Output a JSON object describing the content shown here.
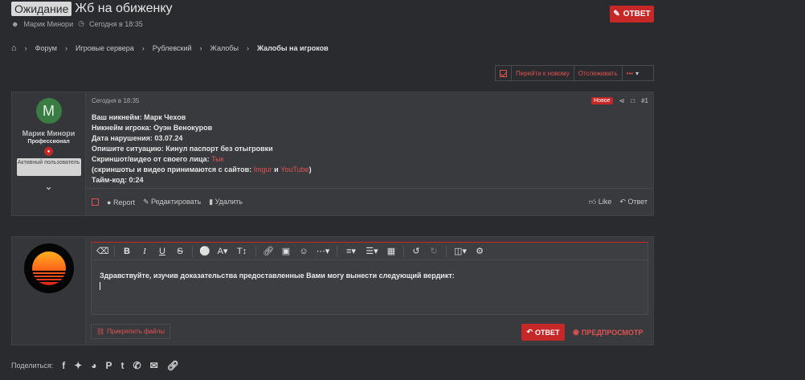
{
  "header": {
    "prefix": "Ожидание",
    "title": "Жб на обиженку",
    "author": "Марик Минори",
    "date": "Сегодня в 18:35",
    "reply_label": "ОТВЕТ"
  },
  "breadcrumb": [
    "Форум",
    "Игровые сервера",
    "Рублевский",
    "Жалобы",
    "Жалобы на игроков"
  ],
  "actions": {
    "goto_new": "Перейти к новому",
    "watch": "Отслеживать",
    "more": "•••"
  },
  "post": {
    "user": {
      "avatar_letter": "M",
      "name": "Марик Минори",
      "title": "Профессионал",
      "badge": "Активный пользователь"
    },
    "date": "Сегодня в 18:35",
    "new_label": "Новое",
    "number": "#1",
    "lines": {
      "l1": "Ваш никнейм: Марк Чехов",
      "l2": "Никнейм игрока: Оуэн Венокуров",
      "l3": "Дата нарушения: 03.07.24",
      "l4": "Опишите ситуацию: Кинул паспорт без отыгровки",
      "l5_prefix": "Скриншот/видео от своего лица: ",
      "l5_link": "Тык",
      "l6_prefix": "(скриншоты и видео принимаются с сайтов: ",
      "l6_link1": "Imgur",
      "l6_and": " и ",
      "l6_link2": "YouTube",
      "l6_suffix": ")",
      "l7": "Тайм-код: 0:24"
    },
    "footer": {
      "report": "Report",
      "edit": "Редактировать",
      "delete": "Удалить",
      "like": "Like",
      "reply": "Ответ"
    }
  },
  "reply_box": {
    "text": "Здравствуйте, изучив доказательства предоставленные Вами могу вынести следующий вердикт:",
    "attach": "Прикрепить файлы",
    "submit": "ОТВЕТ",
    "preview": "ПРЕДПРОСМОТР"
  },
  "share": {
    "label": "Поделиться:"
  },
  "colors": {
    "accent": "#c62828",
    "link": "#e05252",
    "background": "#2a2b2e"
  }
}
